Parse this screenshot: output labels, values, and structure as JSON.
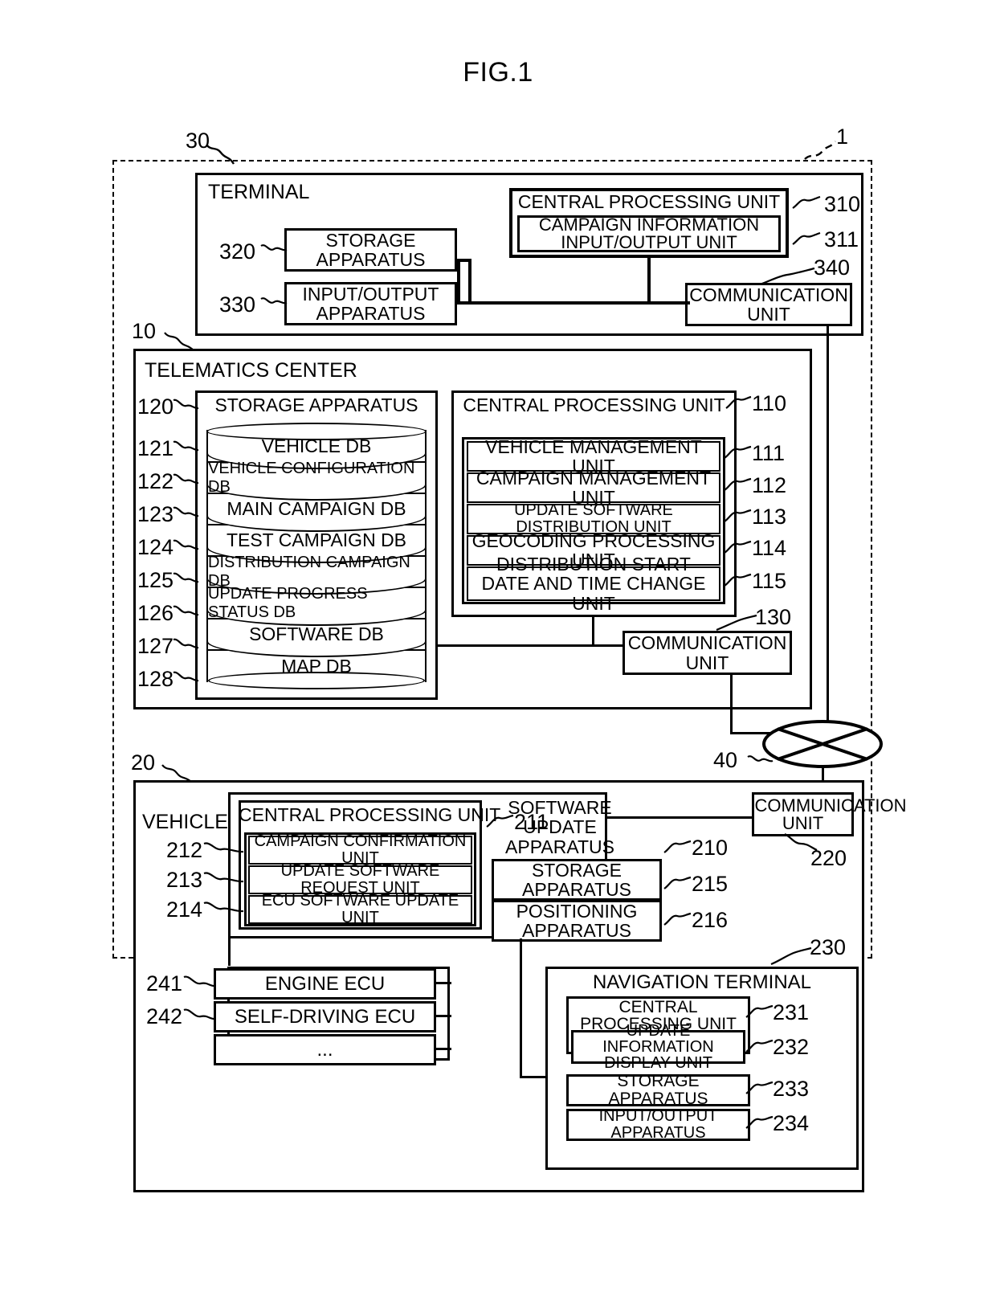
{
  "figure": {
    "title": "FIG.1",
    "system_ref": "1"
  },
  "terminal": {
    "ref": "30",
    "label": "TERMINAL",
    "storage_apparatus": {
      "ref": "320",
      "label": "STORAGE APPARATUS"
    },
    "input_output_apparatus": {
      "ref": "330",
      "label": "INPUT/OUTPUT APPARATUS"
    },
    "cpu": {
      "ref": "310",
      "label": "CENTRAL PROCESSING UNIT"
    },
    "campaign_io_unit": {
      "ref": "311",
      "label": "CAMPAIGN INFORMATION INPUT/OUTPUT UNIT"
    },
    "communication_unit": {
      "ref": "340",
      "label": "COMMUNICATION UNIT"
    }
  },
  "telematics_center": {
    "ref": "10",
    "label": "TELEMATICS CENTER",
    "storage_apparatus": {
      "ref": "120",
      "label": "STORAGE APPARATUS"
    },
    "databases": [
      {
        "ref": "121",
        "label": "VEHICLE DB"
      },
      {
        "ref": "122",
        "label": "VEHICLE CONFIGURATION DB"
      },
      {
        "ref": "123",
        "label": "MAIN CAMPAIGN DB"
      },
      {
        "ref": "124",
        "label": "TEST CAMPAIGN DB"
      },
      {
        "ref": "125",
        "label": "DISTRIBUTION CAMPAIGN DB"
      },
      {
        "ref": "126",
        "label": "UPDATE PROGRESS STATUS DB"
      },
      {
        "ref": "127",
        "label": "SOFTWARE DB"
      },
      {
        "ref": "128",
        "label": "MAP DB"
      }
    ],
    "cpu": {
      "ref": "110",
      "label": "CENTRAL PROCESSING UNIT"
    },
    "cpu_units": [
      {
        "ref": "111",
        "label": "VEHICLE MANAGEMENT UNIT"
      },
      {
        "ref": "112",
        "label": "CAMPAIGN MANAGEMENT UNIT"
      },
      {
        "ref": "113",
        "label": "UPDATE SOFTWARE DISTRIBUTION UNIT"
      },
      {
        "ref": "114",
        "label": "GEOCODING PROCESSING UNIT"
      },
      {
        "ref": "115",
        "label": "DISTRIBUTION START DATE AND TIME CHANGE UNIT"
      }
    ],
    "communication_unit": {
      "ref": "130",
      "label": "COMMUNICATION UNIT"
    }
  },
  "network": {
    "ref": "40",
    "icon": "network-cloud-icon"
  },
  "vehicle": {
    "ref": "20",
    "label": "VEHICLE",
    "software_update_apparatus": {
      "ref": "210",
      "label": "SOFTWARE UPDATE APPARATUS"
    },
    "cpu": {
      "ref": "211",
      "label": "CENTRAL PROCESSING UNIT"
    },
    "cpu_units": [
      {
        "ref": "212",
        "label": "CAMPAIGN CONFIRMATION UNIT"
      },
      {
        "ref": "213",
        "label": "UPDATE SOFTWARE REQUEST UNIT"
      },
      {
        "ref": "214",
        "label": "ECU SOFTWARE UPDATE UNIT"
      }
    ],
    "storage_apparatus": {
      "ref": "215",
      "label": "STORAGE APPARATUS"
    },
    "positioning_apparatus": {
      "ref": "216",
      "label": "POSITIONING APPARATUS"
    },
    "communication_unit": {
      "ref": "220",
      "label": "COMMUNICATION UNIT"
    },
    "ecus": [
      {
        "ref": "241",
        "label": "ENGINE ECU"
      },
      {
        "ref": "242",
        "label": "SELF-DRIVING ECU"
      },
      {
        "ref": "",
        "label": "..."
      }
    ],
    "navigation_terminal": {
      "ref": "230",
      "label": "NAVIGATION TERMINAL",
      "cpu": {
        "ref": "231",
        "label": "CENTRAL PROCESSING UNIT"
      },
      "update_info_display_unit": {
        "ref": "232",
        "label": "UPDATE INFORMATION DISPLAY UNIT"
      },
      "storage_apparatus": {
        "ref": "233",
        "label": "STORAGE APPARATUS"
      },
      "input_output_apparatus": {
        "ref": "234",
        "label": "INPUT/OUTPUT APPARATUS"
      }
    }
  }
}
